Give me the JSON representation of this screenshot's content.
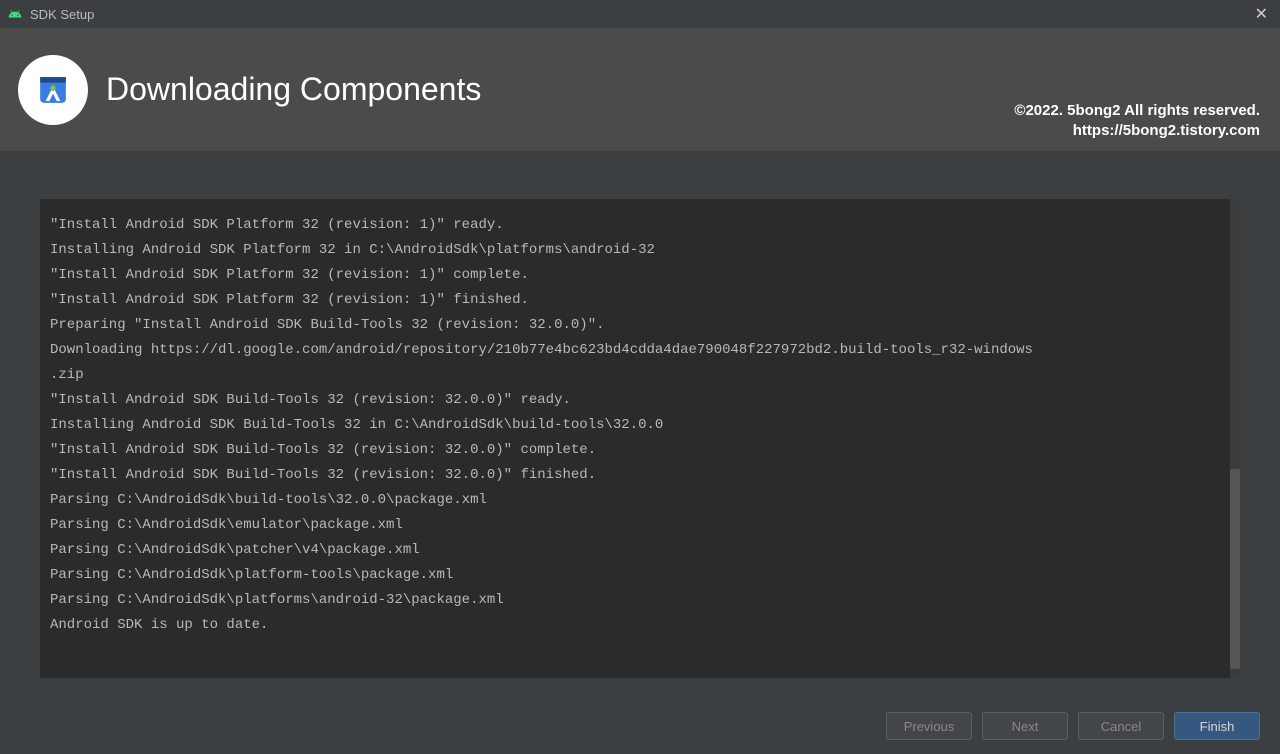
{
  "titlebar": {
    "title": "SDK Setup"
  },
  "header": {
    "title": "Downloading Components"
  },
  "watermark": {
    "line1": "©2022. 5bong2 All rights reserved.",
    "line2": "https://5bong2.tistory.com"
  },
  "log": "\"Install Android SDK Platform 32 (revision: 1)\" ready.\nInstalling Android SDK Platform 32 in C:\\AndroidSdk\\platforms\\android-32\n\"Install Android SDK Platform 32 (revision: 1)\" complete.\n\"Install Android SDK Platform 32 (revision: 1)\" finished.\nPreparing \"Install Android SDK Build-Tools 32 (revision: 32.0.0)\".\nDownloading https://dl.google.com/android/repository/210b77e4bc623bd4cdda4dae790048f227972bd2.build-tools_r32-windows\n.zip\n\"Install Android SDK Build-Tools 32 (revision: 32.0.0)\" ready.\nInstalling Android SDK Build-Tools 32 in C:\\AndroidSdk\\build-tools\\32.0.0\n\"Install Android SDK Build-Tools 32 (revision: 32.0.0)\" complete.\n\"Install Android SDK Build-Tools 32 (revision: 32.0.0)\" finished.\nParsing C:\\AndroidSdk\\build-tools\\32.0.0\\package.xml\nParsing C:\\AndroidSdk\\emulator\\package.xml\nParsing C:\\AndroidSdk\\patcher\\v4\\package.xml\nParsing C:\\AndroidSdk\\platform-tools\\package.xml\nParsing C:\\AndroidSdk\\platforms\\android-32\\package.xml\nAndroid SDK is up to date.",
  "buttons": {
    "previous": "Previous",
    "next": "Next",
    "cancel": "Cancel",
    "finish": "Finish"
  }
}
